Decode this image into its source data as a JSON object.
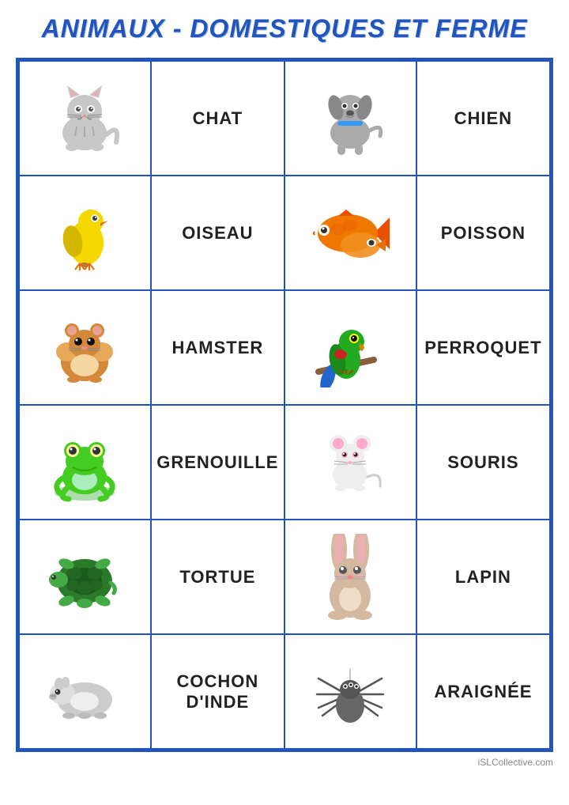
{
  "title": "ANIMAUX - DOMESTIQUES ET FERME",
  "footer": "iSLCollective.com",
  "rows": [
    {
      "col1": {
        "type": "image",
        "name": "chat",
        "emoji": "🐱",
        "color": "#aaa"
      },
      "col2": {
        "type": "label",
        "text": "CHAT"
      },
      "col3": {
        "type": "image",
        "name": "chien",
        "emoji": "🐶",
        "color": "#999"
      },
      "col4": {
        "type": "label",
        "text": "CHIEN"
      }
    },
    {
      "col1": {
        "type": "image",
        "name": "oiseau",
        "emoji": "🐦",
        "color": "#e8c200"
      },
      "col2": {
        "type": "label",
        "text": "OISEAU"
      },
      "col3": {
        "type": "image",
        "name": "poisson",
        "emoji": "🐠",
        "color": "#e87000"
      },
      "col4": {
        "type": "label",
        "text": "POISSON"
      }
    },
    {
      "col1": {
        "type": "image",
        "name": "hamster",
        "emoji": "🐹",
        "color": "#c87030"
      },
      "col2": {
        "type": "label",
        "text": "HAMSTER"
      },
      "col3": {
        "type": "image",
        "name": "perroquet",
        "emoji": "🦜",
        "color": "#22aa22"
      },
      "col4": {
        "type": "label",
        "text": "PERROQUET"
      }
    },
    {
      "col1": {
        "type": "image",
        "name": "grenouille",
        "emoji": "🐸",
        "color": "#44cc22"
      },
      "col2": {
        "type": "label",
        "text": "GRENOUILLE"
      },
      "col3": {
        "type": "image",
        "name": "souris",
        "emoji": "🐭",
        "color": "#ddd"
      },
      "col4": {
        "type": "label",
        "text": "SOURIS"
      }
    },
    {
      "col1": {
        "type": "image",
        "name": "tortue",
        "emoji": "🐢",
        "color": "#226600"
      },
      "col2": {
        "type": "label",
        "text": "TORTUE"
      },
      "col3": {
        "type": "image",
        "name": "lapin",
        "emoji": "🐰",
        "color": "#d4b8a0"
      },
      "col4": {
        "type": "label",
        "text": "LAPIN"
      }
    },
    {
      "col1": {
        "type": "image",
        "name": "cochon-dinde",
        "emoji": "🐾",
        "color": "#bbb"
      },
      "col2": {
        "type": "label",
        "text": "COCHON\nD'INDE"
      },
      "col3": {
        "type": "image",
        "name": "araignee",
        "emoji": "🕷",
        "color": "#555"
      },
      "col4": {
        "type": "label",
        "text": "ARAIGNÉE"
      }
    }
  ]
}
